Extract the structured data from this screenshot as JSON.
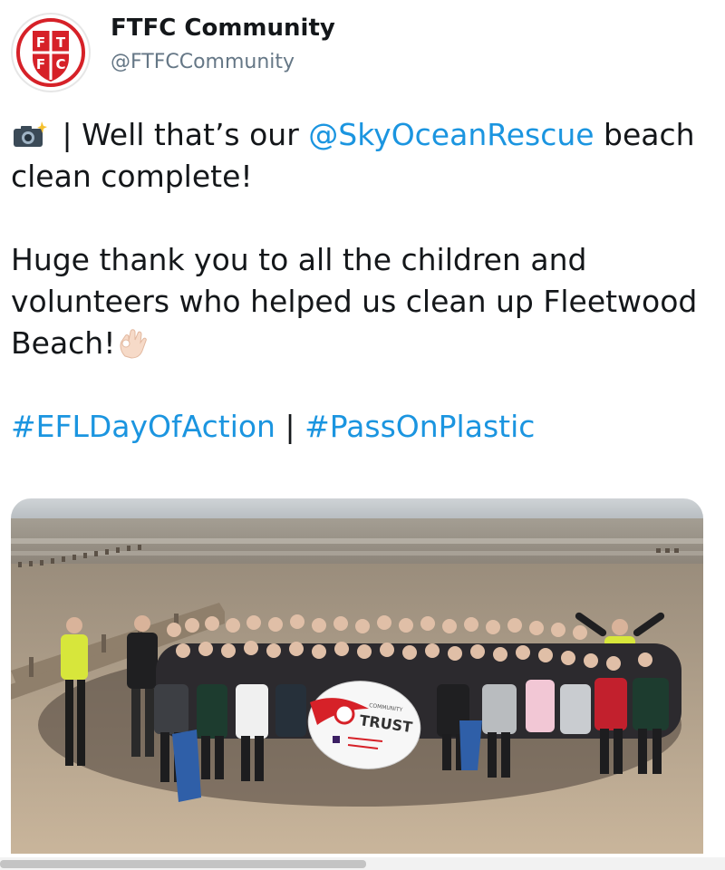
{
  "account": {
    "display_name": "FTFC Community",
    "handle": "@FTFCCommunity",
    "avatar_letters": [
      "F",
      "T",
      "F",
      "C"
    ]
  },
  "tweet": {
    "line1_prefix": " | Well that’s our ",
    "mention": "@SkyOceanRescue",
    "line1_suffix": " beach clean complete!",
    "paragraph2": "Huge thank you to all the children and volunteers who helped us clean up Fleetwood Beach!",
    "hashtag1": "#EFLDayOfAction",
    "separator": " | ",
    "hashtag2": "#PassOnPlastic",
    "emoji_camera": "camera-with-flash",
    "emoji_ok": "ok-hand"
  },
  "photo": {
    "banner_community": "COMMUNITY",
    "banner_trust": "TRUST"
  },
  "colors": {
    "link": "#1b95e0",
    "text": "#14171a",
    "secondary": "#657786",
    "club_red": "#d62128"
  }
}
